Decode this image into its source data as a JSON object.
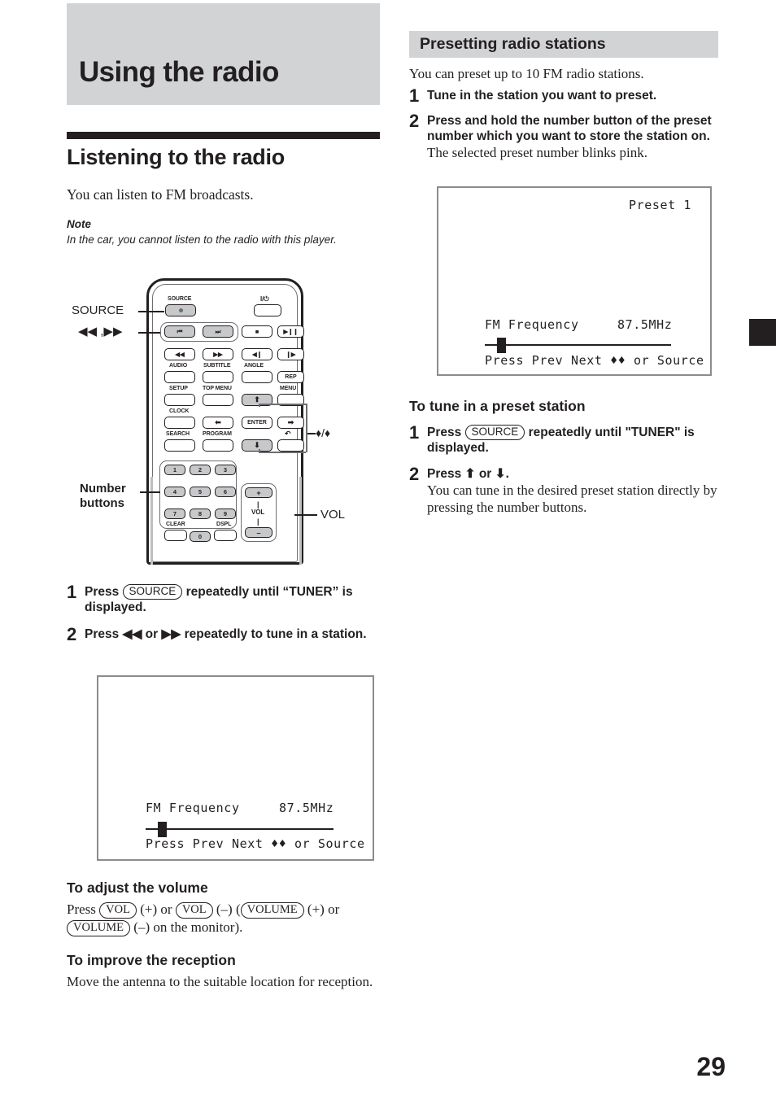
{
  "page": {
    "folio": "29",
    "chapter_title": "Using the radio"
  },
  "left_column": {
    "section_heading": "Listening to the radio",
    "intro": "You can listen to FM broadcasts.",
    "note": {
      "label": "Note",
      "text": "In the car, you cannot listen to the radio with this player."
    },
    "steps": [
      {
        "number": "1",
        "text_before": "Press",
        "button": "SOURCE",
        "text_after": "repeatedly until “TUNER” is displayed."
      },
      {
        "number": "2",
        "text": "Press ◀◀ or ▶▶ repeatedly to tune in a station.",
        "text_raw": "Press |<< or >>| repeatedly to tune in a station."
      }
    ],
    "display_screen": {
      "label": "FM Frequency",
      "value": "87.5MHz",
      "hint": "Press Prev Next ♦♦ or Source",
      "slider_position_percent": 8
    },
    "volume_section": {
      "heading": "To adjust the volume",
      "line1_pre": "Press",
      "vol_token": "VOL",
      "plus": "(+)",
      "or": "or",
      "minus": "(–)",
      "volume_token": "VOLUME",
      "line_text": "Press (VOL) (+) or (VOL) (–) ((VOLUME) (+) or (VOLUME) (–) on the monitor)."
    },
    "reception_section": {
      "heading": "To improve the reception",
      "body": "Move the antenna to the suitable location for reception."
    }
  },
  "right_column": {
    "section_heading": "Presetting radio stations",
    "intro": "You can preset up to 10 FM radio stations.",
    "steps": [
      {
        "number": "1",
        "text": "Tune in the station you want to preset."
      },
      {
        "number": "2",
        "text": "Press and hold the number button of the preset number which you want to store the station on.",
        "sub": "The selected preset number blinks pink."
      }
    ],
    "display_screen": {
      "preset_label": "Preset 1",
      "label": "FM Frequency",
      "value": "87.5MHz",
      "hint": "Press Prev Next ♦♦ or Source",
      "slider_position_percent": 8
    },
    "preset_tune_section": {
      "heading": "To tune in a preset station",
      "steps": [
        {
          "number": "1",
          "text_before": "Press",
          "button": "SOURCE",
          "text_after": "repeatedly until \"TUNER\" is displayed."
        },
        {
          "number": "2",
          "text": "Press ⬆ or ⬇.",
          "sub": "You can tune in the desired preset station directly by pressing the number buttons."
        }
      ]
    }
  },
  "remote": {
    "callouts": {
      "source": "SOURCE",
      "prev_next": "◀◀ ,▶▶",
      "updown": "♦/♦",
      "number_buttons_l1": "Number",
      "number_buttons_l2": "buttons",
      "vol": "VOL"
    },
    "labels": {
      "source": "SOURCE",
      "power": "I/⏻",
      "audio": "AUDIO",
      "subtitle": "SUBTITLE",
      "angle": "ANGLE",
      "rep": "REP",
      "setup": "SETUP",
      "top_menu": "TOP MENU",
      "menu": "MENU",
      "clock": "CLOCK",
      "enter": "ENTER",
      "search": "SEARCH",
      "program": "PROGRAM",
      "return": "↶",
      "clear": "CLEAR",
      "dspl": "DSPL",
      "vol": "VOL",
      "vol_plus": "+",
      "vol_minus": "–"
    },
    "transport": {
      "prev": "⏮",
      "next": "⏭",
      "stop": "■",
      "play_pause": "▶❙❙",
      "rew": "◀◀",
      "ff": "▶▶",
      "step_back": "◀❙",
      "step_fwd": "❙▶"
    },
    "dpad": {
      "up": "⬆",
      "down": "⬇",
      "left": "⬅",
      "right": "➡"
    },
    "number_keys": [
      "1",
      "2",
      "3",
      "4",
      "5",
      "6",
      "7",
      "8",
      "9",
      "0"
    ]
  },
  "colors": {
    "banner_gray": "#d2d3d5",
    "ink": "#231f20",
    "button_gray": "#c7c8ca",
    "outline_gray": "#6d6e71",
    "screen_border": "#8a8c8e"
  }
}
